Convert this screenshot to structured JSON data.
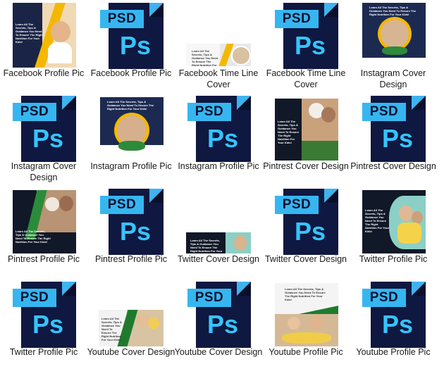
{
  "files": [
    {
      "label": "Facebook Profile Pic",
      "kind": "image",
      "variant": "fb-profile"
    },
    {
      "label": "Facebook Profile Pic",
      "kind": "psd"
    },
    {
      "label": "Facebook Time Line Cover",
      "kind": "image",
      "variant": "fb-cover"
    },
    {
      "label": "Facebook Time Line Cover",
      "kind": "psd"
    },
    {
      "label": "Instagram Cover Design",
      "kind": "image",
      "variant": "insta-cover"
    },
    {
      "label": "Instagram Cover Design",
      "kind": "psd"
    },
    {
      "label": "Instagram Profile Pic",
      "kind": "image",
      "variant": "insta-profile"
    },
    {
      "label": "Instagram Profile Pic",
      "kind": "psd"
    },
    {
      "label": "Pintrest Cover Design",
      "kind": "image",
      "variant": "pin-cover"
    },
    {
      "label": "Pintrest Cover Design",
      "kind": "psd"
    },
    {
      "label": "Pintrest Profile Pic",
      "kind": "image",
      "variant": "pin-profile"
    },
    {
      "label": "Pintrest Profile Pic",
      "kind": "psd"
    },
    {
      "label": "Twitter Cover Design",
      "kind": "image",
      "variant": "tw-cover"
    },
    {
      "label": "Twitter Cover Design",
      "kind": "psd"
    },
    {
      "label": "Twitter Profile Pic",
      "kind": "image",
      "variant": "tw-profile"
    },
    {
      "label": "Twitter Profile Pic",
      "kind": "psd"
    },
    {
      "label": "Youtube Cover Design",
      "kind": "image",
      "variant": "yt-cover"
    },
    {
      "label": "Youtube Cover Design",
      "kind": "psd"
    },
    {
      "label": "Youtube Profile Pic",
      "kind": "image",
      "variant": "yt-profile"
    },
    {
      "label": "Youtube Profile Pic",
      "kind": "psd"
    }
  ],
  "psd_icon": {
    "tab_text": "PSD",
    "logo_text": "Ps"
  },
  "thumb_text": {
    "headline": "Learn All The Secrets, Tips & Guidance You Need To Ensure The Right Nutrition For Your Kids!"
  },
  "colors": {
    "psd_page": "#0f1840",
    "psd_tab": "#36b6f0",
    "psd_logo": "#35c4ff",
    "accent_yellow": "#f5b800",
    "accent_green": "#1f7a2e"
  }
}
